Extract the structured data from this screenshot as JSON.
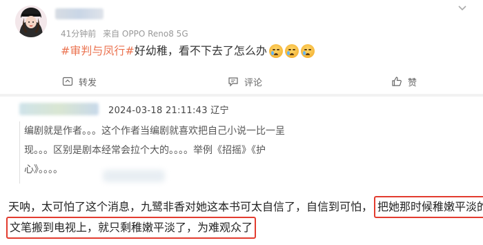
{
  "post": {
    "meta_time": "41分钟前",
    "meta_from": "来自 OPPO Reno8 5G",
    "hashtag": "#审判与凤行#",
    "text": "好幼稚，看不下去了怎么办",
    "actions": {
      "repost": "转发",
      "comment": "评论",
      "like": "赞"
    }
  },
  "comment": {
    "timestamp": "2024-03-18 21:11:43 辽宁",
    "quote_lines": [
      "编剧就是作者。。。这个作者当编剧就喜欢把自己小说一比一呈",
      "现。。。区别是剧本经常会拉个大的。。。。举例《招摇》《护",
      "心》。。。。"
    ],
    "reply_line1_plain": "天呐，太可怕了这个消息，九鹭非香对她这本书可太自信了，自信到可怕，",
    "reply_line1_highlight": "把她那时候稚嫩平淡的",
    "reply_line2_highlight": "文笔搬到电视上，就只剩稚嫩平淡了，为难观众了"
  },
  "colors": {
    "hashtag": "#eb7350",
    "highlight_border": "#e23b2e"
  }
}
